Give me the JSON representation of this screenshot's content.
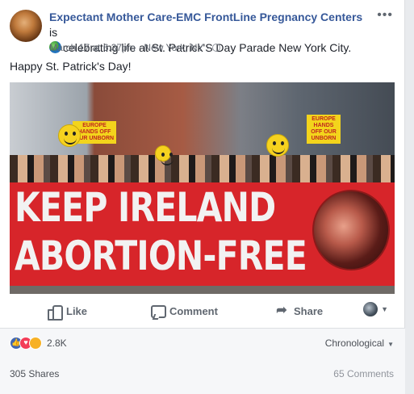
{
  "post": {
    "page_name": "Expectant Mother Care-EMC FrontLine Pregnancy Centers",
    "is_word": "is",
    "activity": "celebrating life at St. Patrick'S Day Parade New York City.",
    "date": "March 17 at 6:37pm",
    "location": "New York, NY",
    "separator": "·",
    "more_label": "•••",
    "text": "Happy St. Patrick's Day!"
  },
  "image": {
    "banner_line1": "KEEP IRELAND",
    "banner_line2": "ABORTION-FREE",
    "sign_text": "EUROPE HANDS OFF OUR UNBORN"
  },
  "actions": {
    "like_label": "Like",
    "comment_label": "Comment",
    "share_label": "Share"
  },
  "stats": {
    "reaction_count": "2.8K",
    "sort_label": "Chronological",
    "shares_label": "305 Shares",
    "comments_label": "65 Comments"
  },
  "icons": {
    "globe": "globe-icon",
    "public": "public-icon",
    "like": "thumbs-up-icon",
    "comment": "speech-bubble-icon",
    "share": "share-arrow-icon"
  },
  "colors": {
    "link_blue": "#365899",
    "banner_red": "#d7252a",
    "like_blue": "#4267b2",
    "love_red": "#f33e58",
    "sad_yellow": "#f7b125"
  }
}
